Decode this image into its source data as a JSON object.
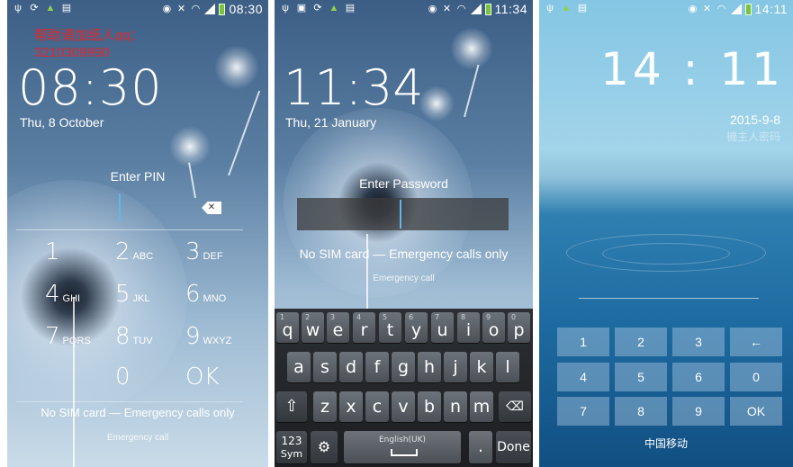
{
  "panel1": {
    "status": {
      "time": "08:30"
    },
    "overlay_text": "帮助请加纸人qq：3210309990",
    "clock": "08:30",
    "date": "Thu, 8 October",
    "prompt": "Enter PIN",
    "keys": [
      {
        "digit": "1",
        "letters": ""
      },
      {
        "digit": "2",
        "letters": "ABC"
      },
      {
        "digit": "3",
        "letters": "DEF"
      },
      {
        "digit": "4",
        "letters": "GHI"
      },
      {
        "digit": "5",
        "letters": "JKL"
      },
      {
        "digit": "6",
        "letters": "MNO"
      },
      {
        "digit": "7",
        "letters": "PQRS"
      },
      {
        "digit": "8",
        "letters": "TUV"
      },
      {
        "digit": "9",
        "letters": "WXYZ"
      },
      {
        "digit": "0",
        "letters": ""
      },
      {
        "digit": "OK",
        "letters": ""
      }
    ],
    "no_sim": "No SIM card — Emergency calls only",
    "emergency": "Emergency call"
  },
  "panel2": {
    "status": {
      "time": "11:34"
    },
    "clock": "11:34",
    "date": "Thu, 21 January",
    "prompt": "Enter Password",
    "no_sim": "No SIM card — Emergency calls only",
    "emergency": "Emergency call",
    "keyboard": {
      "row1": [
        {
          "n": "1",
          "c": "q"
        },
        {
          "n": "2",
          "c": "w"
        },
        {
          "n": "3",
          "c": "e"
        },
        {
          "n": "4",
          "c": "r"
        },
        {
          "n": "5",
          "c": "t"
        },
        {
          "n": "6",
          "c": "y"
        },
        {
          "n": "7",
          "c": "u"
        },
        {
          "n": "8",
          "c": "i"
        },
        {
          "n": "9",
          "c": "o"
        },
        {
          "n": "0",
          "c": "p"
        }
      ],
      "row2": [
        "a",
        "s",
        "d",
        "f",
        "g",
        "h",
        "j",
        "k",
        "l"
      ],
      "row3": [
        "z",
        "x",
        "c",
        "v",
        "b",
        "n",
        "m"
      ],
      "sym_label": "123",
      "sym_sub": "Sym",
      "space_label": "English(UK)",
      "period": ".",
      "done": "Done"
    }
  },
  "panel3": {
    "status": {
      "time": "14:11"
    },
    "clock": "14 : 11",
    "date": "2015-9-8",
    "owner": "機主人密码",
    "keys": [
      "1",
      "2",
      "3",
      "←",
      "4",
      "5",
      "6",
      "0",
      "7",
      "8",
      "9",
      "OK"
    ],
    "carrier": "中国移动"
  }
}
